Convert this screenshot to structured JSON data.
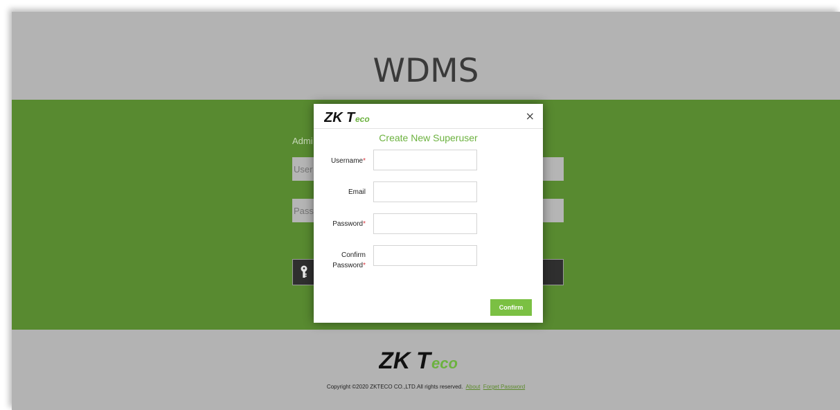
{
  "app": {
    "title": "WDMS"
  },
  "login": {
    "heading_partial": "Admi",
    "username_placeholder": "User",
    "password_placeholder": "Pass"
  },
  "modal": {
    "brand": "ZKTeco",
    "close_symbol": "×",
    "title": "Create New Superuser",
    "fields": {
      "username_label": "Username",
      "email_label": "Email",
      "password_label": "Password",
      "confirm_label_line1": "Confirm",
      "confirm_label_line2": "Password",
      "required_mark": "*"
    },
    "confirm_button": "Confirm"
  },
  "footer": {
    "brand": "ZKTeco",
    "copyright": "Copyright ©2020 ZKTECO CO.,LTD.All rights reserved.",
    "about_link": "About",
    "forget_link": "Forget Password"
  },
  "colors": {
    "green_band": "#588a30",
    "accent_green": "#7bc043",
    "required_red": "#d9363e"
  },
  "icons": [
    "key-icon",
    "close-icon",
    "zkteco-logo"
  ]
}
